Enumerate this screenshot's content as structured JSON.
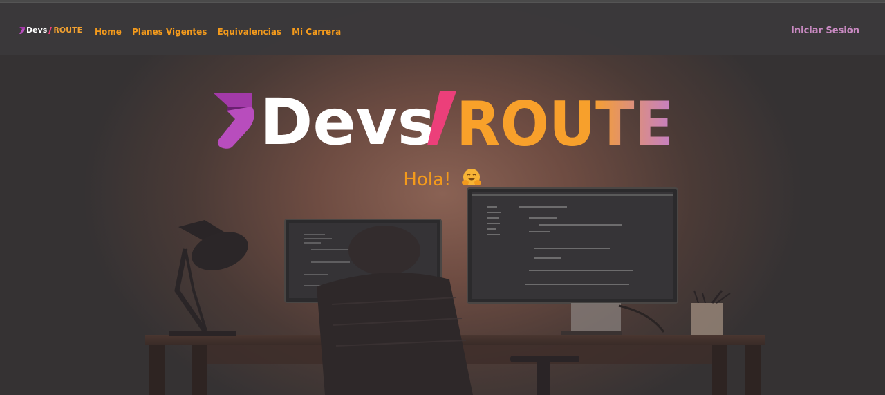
{
  "brand": {
    "part1": "Devs",
    "part2": "ROUTE",
    "colors": {
      "devs": "#ffffff",
      "slash": "#ec3f7a",
      "route_start": "#f9a12a",
      "route_end": "#c47fc7",
      "mark_purple": "#a23aa8",
      "mark_dark": "#6a2070"
    }
  },
  "navbar": {
    "links": [
      {
        "label": "Home"
      },
      {
        "label": "Planes Vigentes"
      },
      {
        "label": "Equivalencias"
      },
      {
        "label": "Mi Carrera"
      }
    ],
    "login_label": "Iniciar Sesión",
    "link_color": "#f39a1c",
    "login_color": "#c98ac2"
  },
  "hero": {
    "greeting": "Hola!",
    "emoji_icon": "hugging-face-icon"
  }
}
